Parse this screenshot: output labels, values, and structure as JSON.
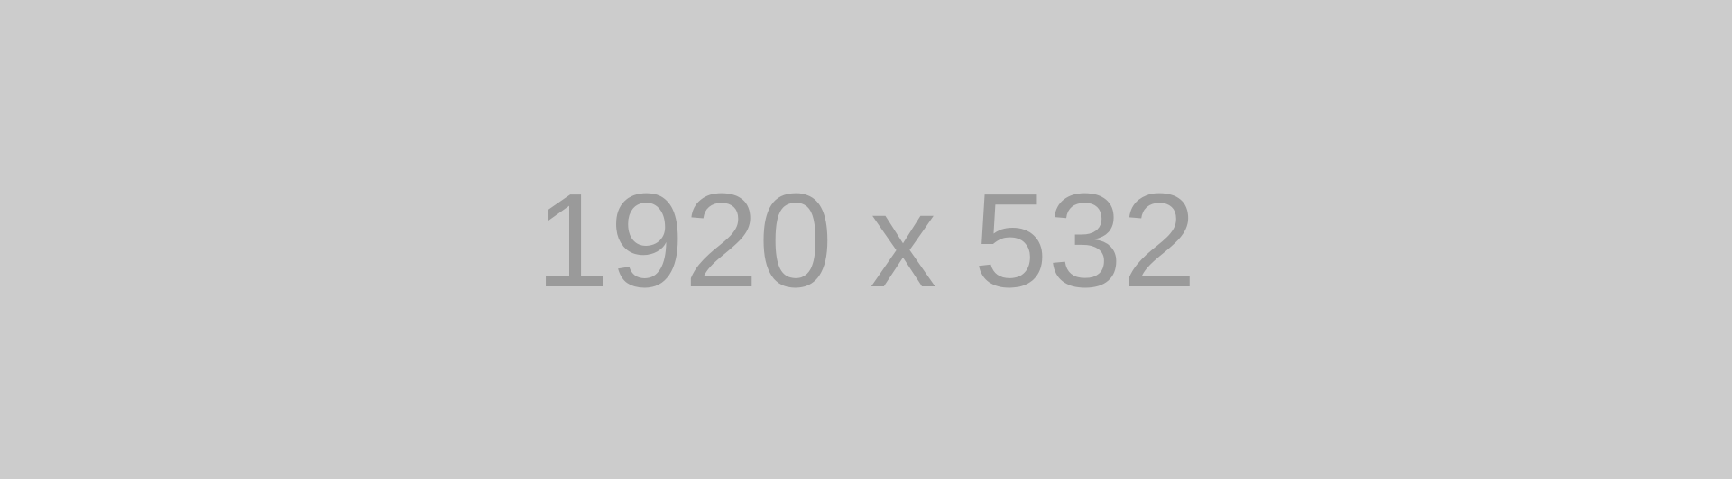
{
  "placeholder": {
    "text": "1920 x 532"
  },
  "colors": {
    "background": "#cccccc",
    "text": "#9a9a9a"
  }
}
